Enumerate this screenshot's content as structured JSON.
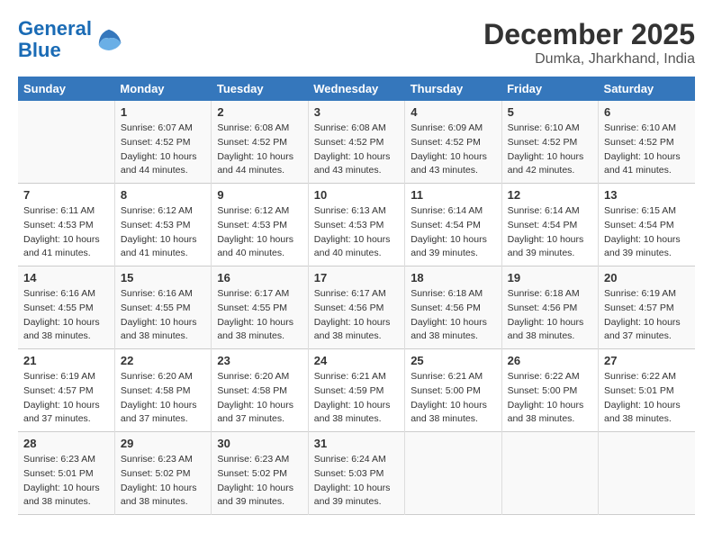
{
  "header": {
    "logo_line1": "General",
    "logo_line2": "Blue",
    "month": "December 2025",
    "location": "Dumka, Jharkhand, India"
  },
  "weekdays": [
    "Sunday",
    "Monday",
    "Tuesday",
    "Wednesday",
    "Thursday",
    "Friday",
    "Saturday"
  ],
  "weeks": [
    [
      {
        "day": "",
        "info": ""
      },
      {
        "day": "1",
        "info": "Sunrise: 6:07 AM\nSunset: 4:52 PM\nDaylight: 10 hours\nand 44 minutes."
      },
      {
        "day": "2",
        "info": "Sunrise: 6:08 AM\nSunset: 4:52 PM\nDaylight: 10 hours\nand 44 minutes."
      },
      {
        "day": "3",
        "info": "Sunrise: 6:08 AM\nSunset: 4:52 PM\nDaylight: 10 hours\nand 43 minutes."
      },
      {
        "day": "4",
        "info": "Sunrise: 6:09 AM\nSunset: 4:52 PM\nDaylight: 10 hours\nand 43 minutes."
      },
      {
        "day": "5",
        "info": "Sunrise: 6:10 AM\nSunset: 4:52 PM\nDaylight: 10 hours\nand 42 minutes."
      },
      {
        "day": "6",
        "info": "Sunrise: 6:10 AM\nSunset: 4:52 PM\nDaylight: 10 hours\nand 41 minutes."
      }
    ],
    [
      {
        "day": "7",
        "info": "Sunrise: 6:11 AM\nSunset: 4:53 PM\nDaylight: 10 hours\nand 41 minutes."
      },
      {
        "day": "8",
        "info": "Sunrise: 6:12 AM\nSunset: 4:53 PM\nDaylight: 10 hours\nand 41 minutes."
      },
      {
        "day": "9",
        "info": "Sunrise: 6:12 AM\nSunset: 4:53 PM\nDaylight: 10 hours\nand 40 minutes."
      },
      {
        "day": "10",
        "info": "Sunrise: 6:13 AM\nSunset: 4:53 PM\nDaylight: 10 hours\nand 40 minutes."
      },
      {
        "day": "11",
        "info": "Sunrise: 6:14 AM\nSunset: 4:54 PM\nDaylight: 10 hours\nand 39 minutes."
      },
      {
        "day": "12",
        "info": "Sunrise: 6:14 AM\nSunset: 4:54 PM\nDaylight: 10 hours\nand 39 minutes."
      },
      {
        "day": "13",
        "info": "Sunrise: 6:15 AM\nSunset: 4:54 PM\nDaylight: 10 hours\nand 39 minutes."
      }
    ],
    [
      {
        "day": "14",
        "info": "Sunrise: 6:16 AM\nSunset: 4:55 PM\nDaylight: 10 hours\nand 38 minutes."
      },
      {
        "day": "15",
        "info": "Sunrise: 6:16 AM\nSunset: 4:55 PM\nDaylight: 10 hours\nand 38 minutes."
      },
      {
        "day": "16",
        "info": "Sunrise: 6:17 AM\nSunset: 4:55 PM\nDaylight: 10 hours\nand 38 minutes."
      },
      {
        "day": "17",
        "info": "Sunrise: 6:17 AM\nSunset: 4:56 PM\nDaylight: 10 hours\nand 38 minutes."
      },
      {
        "day": "18",
        "info": "Sunrise: 6:18 AM\nSunset: 4:56 PM\nDaylight: 10 hours\nand 38 minutes."
      },
      {
        "day": "19",
        "info": "Sunrise: 6:18 AM\nSunset: 4:56 PM\nDaylight: 10 hours\nand 38 minutes."
      },
      {
        "day": "20",
        "info": "Sunrise: 6:19 AM\nSunset: 4:57 PM\nDaylight: 10 hours\nand 37 minutes."
      }
    ],
    [
      {
        "day": "21",
        "info": "Sunrise: 6:19 AM\nSunset: 4:57 PM\nDaylight: 10 hours\nand 37 minutes."
      },
      {
        "day": "22",
        "info": "Sunrise: 6:20 AM\nSunset: 4:58 PM\nDaylight: 10 hours\nand 37 minutes."
      },
      {
        "day": "23",
        "info": "Sunrise: 6:20 AM\nSunset: 4:58 PM\nDaylight: 10 hours\nand 37 minutes."
      },
      {
        "day": "24",
        "info": "Sunrise: 6:21 AM\nSunset: 4:59 PM\nDaylight: 10 hours\nand 38 minutes."
      },
      {
        "day": "25",
        "info": "Sunrise: 6:21 AM\nSunset: 5:00 PM\nDaylight: 10 hours\nand 38 minutes."
      },
      {
        "day": "26",
        "info": "Sunrise: 6:22 AM\nSunset: 5:00 PM\nDaylight: 10 hours\nand 38 minutes."
      },
      {
        "day": "27",
        "info": "Sunrise: 6:22 AM\nSunset: 5:01 PM\nDaylight: 10 hours\nand 38 minutes."
      }
    ],
    [
      {
        "day": "28",
        "info": "Sunrise: 6:23 AM\nSunset: 5:01 PM\nDaylight: 10 hours\nand 38 minutes."
      },
      {
        "day": "29",
        "info": "Sunrise: 6:23 AM\nSunset: 5:02 PM\nDaylight: 10 hours\nand 38 minutes."
      },
      {
        "day": "30",
        "info": "Sunrise: 6:23 AM\nSunset: 5:02 PM\nDaylight: 10 hours\nand 39 minutes."
      },
      {
        "day": "31",
        "info": "Sunrise: 6:24 AM\nSunset: 5:03 PM\nDaylight: 10 hours\nand 39 minutes."
      },
      {
        "day": "",
        "info": ""
      },
      {
        "day": "",
        "info": ""
      },
      {
        "day": "",
        "info": ""
      }
    ]
  ]
}
